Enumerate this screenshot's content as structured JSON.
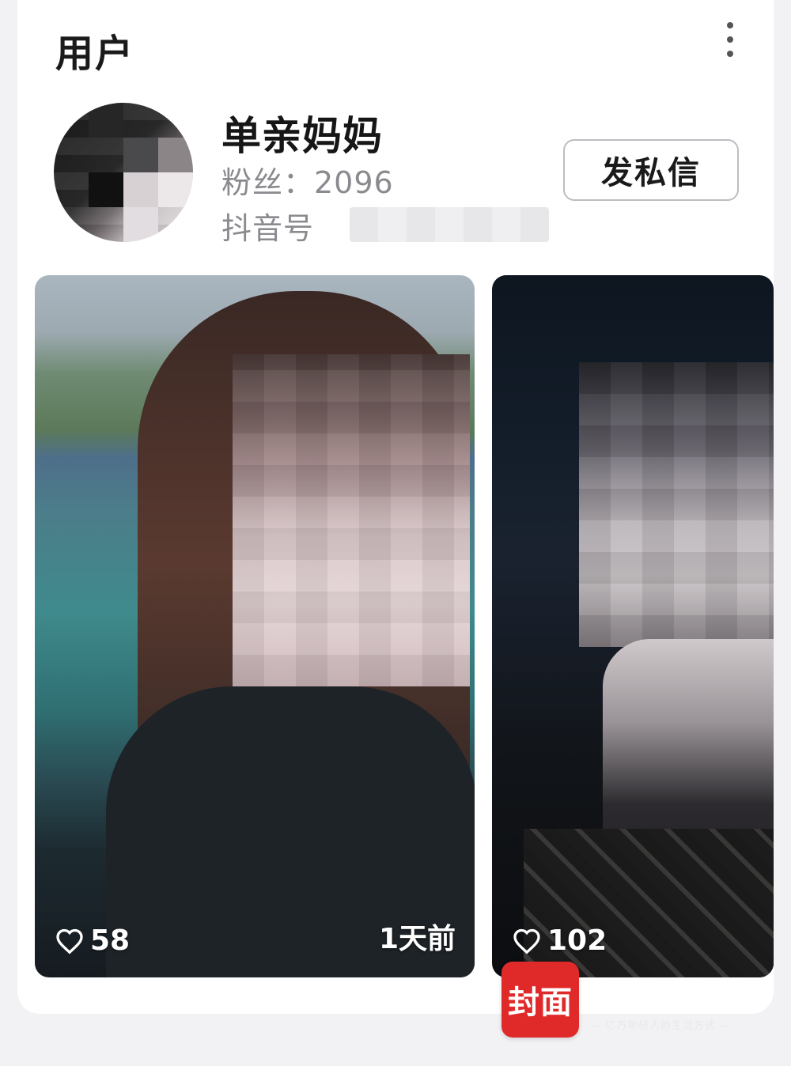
{
  "section": {
    "title": "用户"
  },
  "profile": {
    "name": "单亲妈妈",
    "fans_label": "粉丝：2096",
    "douyin_id_label": "抖音号"
  },
  "actions": {
    "message_label": "发私信"
  },
  "videos": [
    {
      "likes": "58",
      "time": "1天前"
    },
    {
      "likes": "102"
    }
  ],
  "watermark": {
    "logo_text": "封面",
    "tagline": "— 亿万年轻人的生活方式 —"
  },
  "colors": {
    "accent": "#e02a2a",
    "secondary_text": "#8a8a8f"
  }
}
